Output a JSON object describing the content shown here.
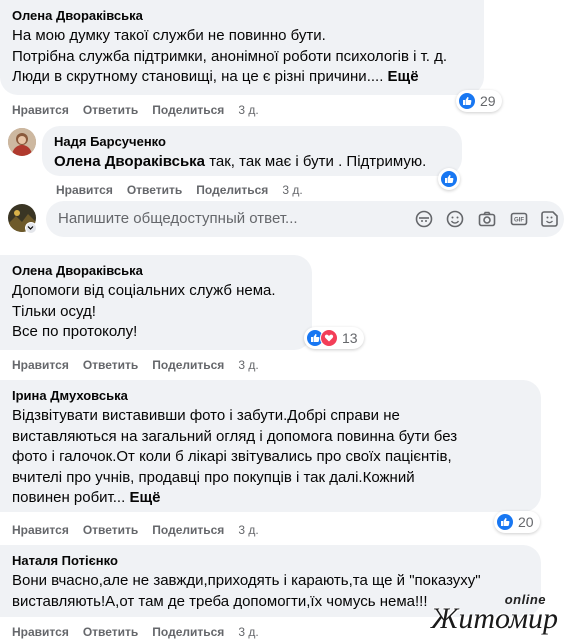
{
  "comments": [
    {
      "author": "Олена Двораківська",
      "lines": [
        "На мою думку такої служби не повинно бути.",
        "Потрібна служба підтримки, анонімної роботи психологів і т. д.",
        "Люди в скрутному становищі, на це є різні причини...."
      ],
      "more_label": "Ещё",
      "like": "Нравится",
      "reply": "Ответить",
      "share": "Поделиться",
      "time": "3 д.",
      "reaction_count": "29"
    },
    {
      "author": "Надя Барсученко",
      "mention": "Олена Двораківська",
      "text": "так, так має і бути . Підтримую.",
      "like": "Нравится",
      "reply": "Ответить",
      "share": "Поделиться",
      "time": "3 д."
    },
    {
      "author": "Олена Двораківська",
      "lines": [
        "Допомоги від соціальних служб нема.",
        "Тільки осуд!",
        "Все по протоколу!"
      ],
      "like": "Нравится",
      "reply": "Ответить",
      "share": "Поделиться",
      "time": "3 д.",
      "reaction_count": "13"
    },
    {
      "author": "Ірина Дмуховська",
      "lines": [
        "Відзвітувати виставивши фото і забути.Добрі справи не",
        "виставляються на загальний огляд і допомога повинна бути без",
        "фото і галочок.От коли б лікарі звітувались про своїх пацієнтів,",
        "вчителі про учнів, продавці про покупців і так далі.Кожний",
        "повинен робит..."
      ],
      "more_label": "Ещё",
      "like": "Нравится",
      "reply": "Ответить",
      "share": "Поделиться",
      "time": "3 д.",
      "reaction_count": "20"
    },
    {
      "author": "Наталя Потієнко",
      "lines": [
        "Вони вчасно,але не завжди,приходять і карають,та ще й \"показуху\"",
        "виставляють!А,от там де треба допомогти,їх чомусь нема!!!"
      ],
      "like": "Нравится",
      "reply": "Ответить",
      "share": "Поделиться",
      "time": "3 д."
    }
  ],
  "reply_input": {
    "placeholder": "Напишите общедоступный ответ..."
  },
  "watermark": {
    "online": "online",
    "brand": "Житомир"
  },
  "colors": {
    "like_blue": "#1877f2",
    "love_red": "#f33e58",
    "bubble": "#f0f2f5",
    "meta": "#65676b"
  }
}
